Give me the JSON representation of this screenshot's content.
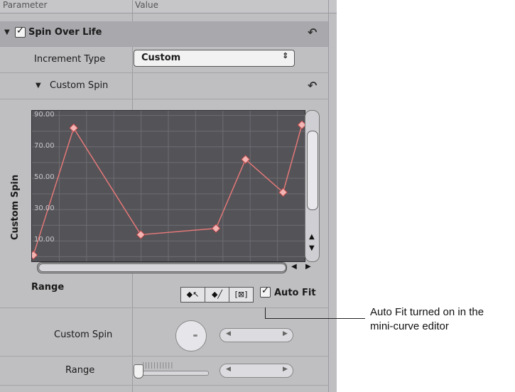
{
  "header": {
    "parameter_label": "Parameter",
    "value_label": "Value"
  },
  "behavior": {
    "name": "Spin Over Life",
    "enabled": true
  },
  "increment_type": {
    "label": "Increment Type",
    "value": "Custom"
  },
  "custom_spin_group": {
    "label": "Custom Spin"
  },
  "mini_curve_editor": {
    "y_axis_label": "Custom Spin",
    "x_axis_label": "Range",
    "auto_fit_label": "Auto Fit",
    "auto_fit_checked": true,
    "tools": [
      "select-keyframe-tool",
      "pen-tool",
      "fit-view-tool"
    ],
    "colors": {
      "graph_bg": "#535358",
      "curve": "#e47878",
      "grid": "#6d6d72"
    }
  },
  "chart_data": {
    "type": "line",
    "title": "",
    "xlabel": "Range",
    "ylabel": "Custom Spin",
    "y_ticks": [
      "90.00",
      "70.00",
      "50.00",
      "30.00",
      "10.00"
    ],
    "ylim": [
      -3,
      93
    ],
    "x": [
      0,
      0.15,
      0.4,
      0.68,
      0.79,
      0.93,
      1.0
    ],
    "series": [
      {
        "values": [
          1,
          82,
          14,
          18,
          62,
          41,
          84
        ]
      }
    ],
    "grid": true
  },
  "custom_spin_param": {
    "label": "Custom Spin"
  },
  "range_param": {
    "label": "Range"
  },
  "callout": {
    "line1": "Auto Fit turned on in the",
    "line2": "mini-curve editor"
  }
}
